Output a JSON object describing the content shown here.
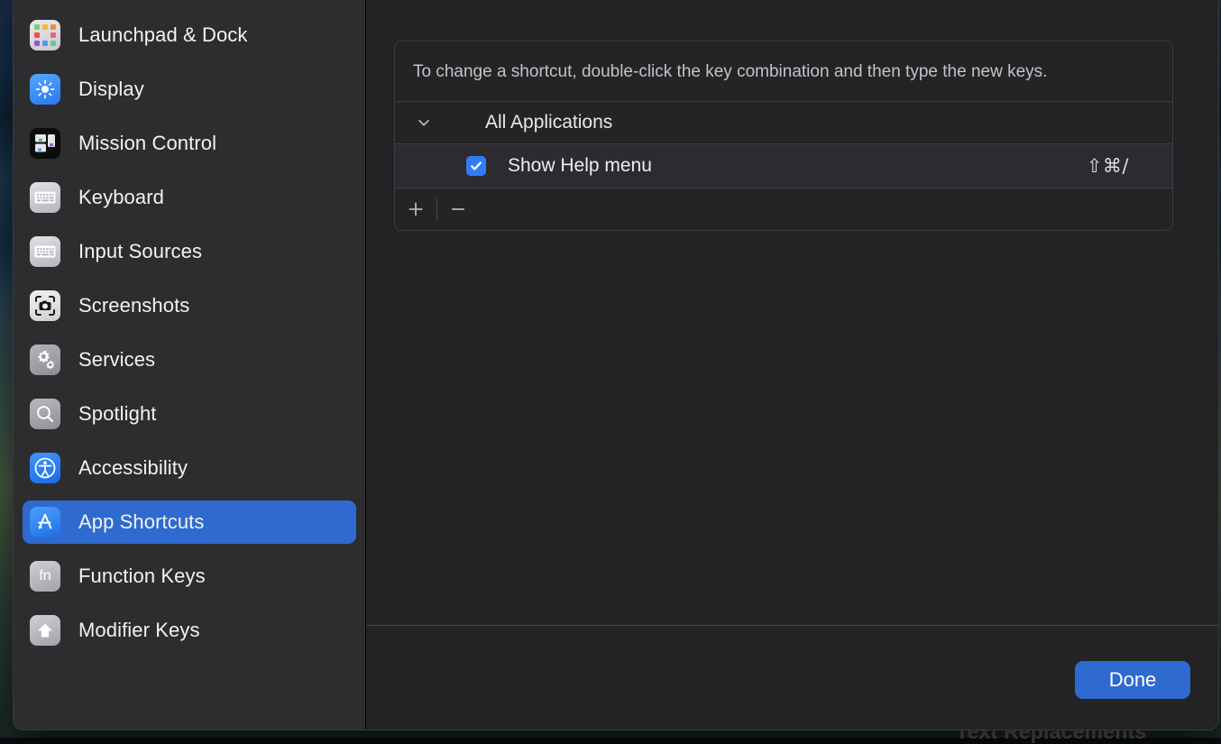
{
  "desktop": {
    "background_window_text": "Text Replacements"
  },
  "window": {
    "accent_color": "#2f6ad0",
    "sidebar_bg": "#2d2d30",
    "content_bg": "#232326"
  },
  "sidebar": {
    "items": [
      {
        "label": "Launchpad & Dock",
        "icon": "launchpad-icon",
        "selected": false
      },
      {
        "label": "Display",
        "icon": "display-brightness-icon",
        "selected": false
      },
      {
        "label": "Mission Control",
        "icon": "mission-control-icon",
        "selected": false
      },
      {
        "label": "Keyboard",
        "icon": "keyboard-icon",
        "selected": false
      },
      {
        "label": "Input Sources",
        "icon": "input-sources-keyboard-icon",
        "selected": false
      },
      {
        "label": "Screenshots",
        "icon": "screenshots-camera-icon",
        "selected": false
      },
      {
        "label": "Services",
        "icon": "services-gears-icon",
        "selected": false
      },
      {
        "label": "Spotlight",
        "icon": "spotlight-magnifier-icon",
        "selected": false
      },
      {
        "label": "Accessibility",
        "icon": "accessibility-icon",
        "selected": false
      },
      {
        "label": "App Shortcuts",
        "icon": "app-shortcuts-icon",
        "selected": true
      },
      {
        "label": "Function Keys",
        "icon": "fn-key-icon",
        "selected": false
      },
      {
        "label": "Modifier Keys",
        "icon": "shift-arrow-icon",
        "selected": false
      }
    ],
    "fn_glyph": "fn"
  },
  "main": {
    "instructions": "To change a shortcut, double-click the key combination and then type the new keys.",
    "group": {
      "label": "All Applications",
      "expanded": true,
      "disclosure_icon": "chevron-down-icon"
    },
    "shortcuts": [
      {
        "enabled": true,
        "title": "Show Help menu",
        "keys": "⇧⌘/"
      }
    ],
    "toolbar": {
      "add_label": "+",
      "remove_label": "−"
    }
  },
  "footer": {
    "done_label": "Done"
  }
}
